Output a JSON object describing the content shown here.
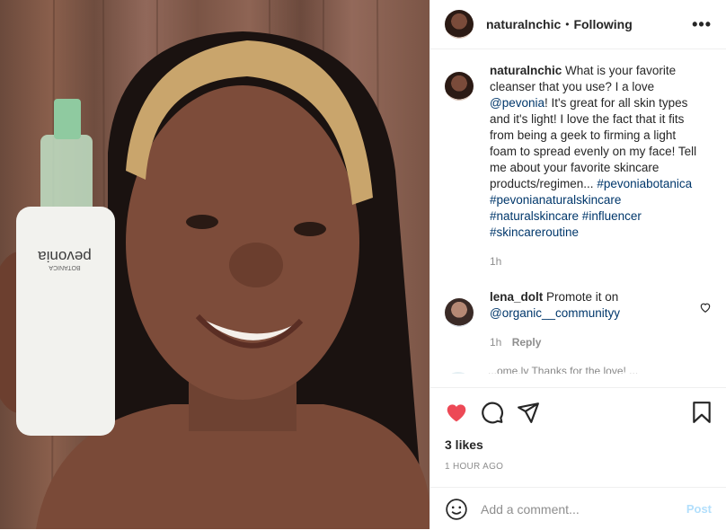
{
  "header": {
    "username": "naturalnchic",
    "separator": "•",
    "follow_status": "Following",
    "more": "•••"
  },
  "caption": {
    "username": "naturalnchic",
    "text_1": "What is your favorite cleanser that you use? I a love",
    "mention": "@pevonia",
    "text_2": "! It's great for all skin types and it's light! I love the fact that it fits from being a geek to firming a light foam to spread evenly on my face! Tell me about your favorite skincare products/regimen...",
    "hashtags": "#pevoniabotanica #pevonianaturalskincare #naturalskincare #influencer #skincareroutine",
    "time": "1h"
  },
  "comment": {
    "username": "lena_dolt",
    "text": "Promote it on",
    "mention": "@organic__communityy",
    "time": "1h",
    "reply": "Reply"
  },
  "partial_comment": "...ome.ly  Thanks for the love! ...",
  "likes": "3 likes",
  "timestamp": "1 HOUR AGO",
  "add_comment": {
    "placeholder": "Add a comment...",
    "post_label": "Post"
  },
  "product": {
    "brand": "pevonia",
    "line": "BOTANICA"
  },
  "icons": [
    "heart-icon",
    "comment-icon",
    "share-icon",
    "bookmark-icon",
    "emoji-icon",
    "more-icon"
  ],
  "colors": {
    "like_red": "#ed4956",
    "link_blue": "#00376b",
    "muted": "#8e8e8e",
    "post_disabled": "#b2dffc"
  }
}
